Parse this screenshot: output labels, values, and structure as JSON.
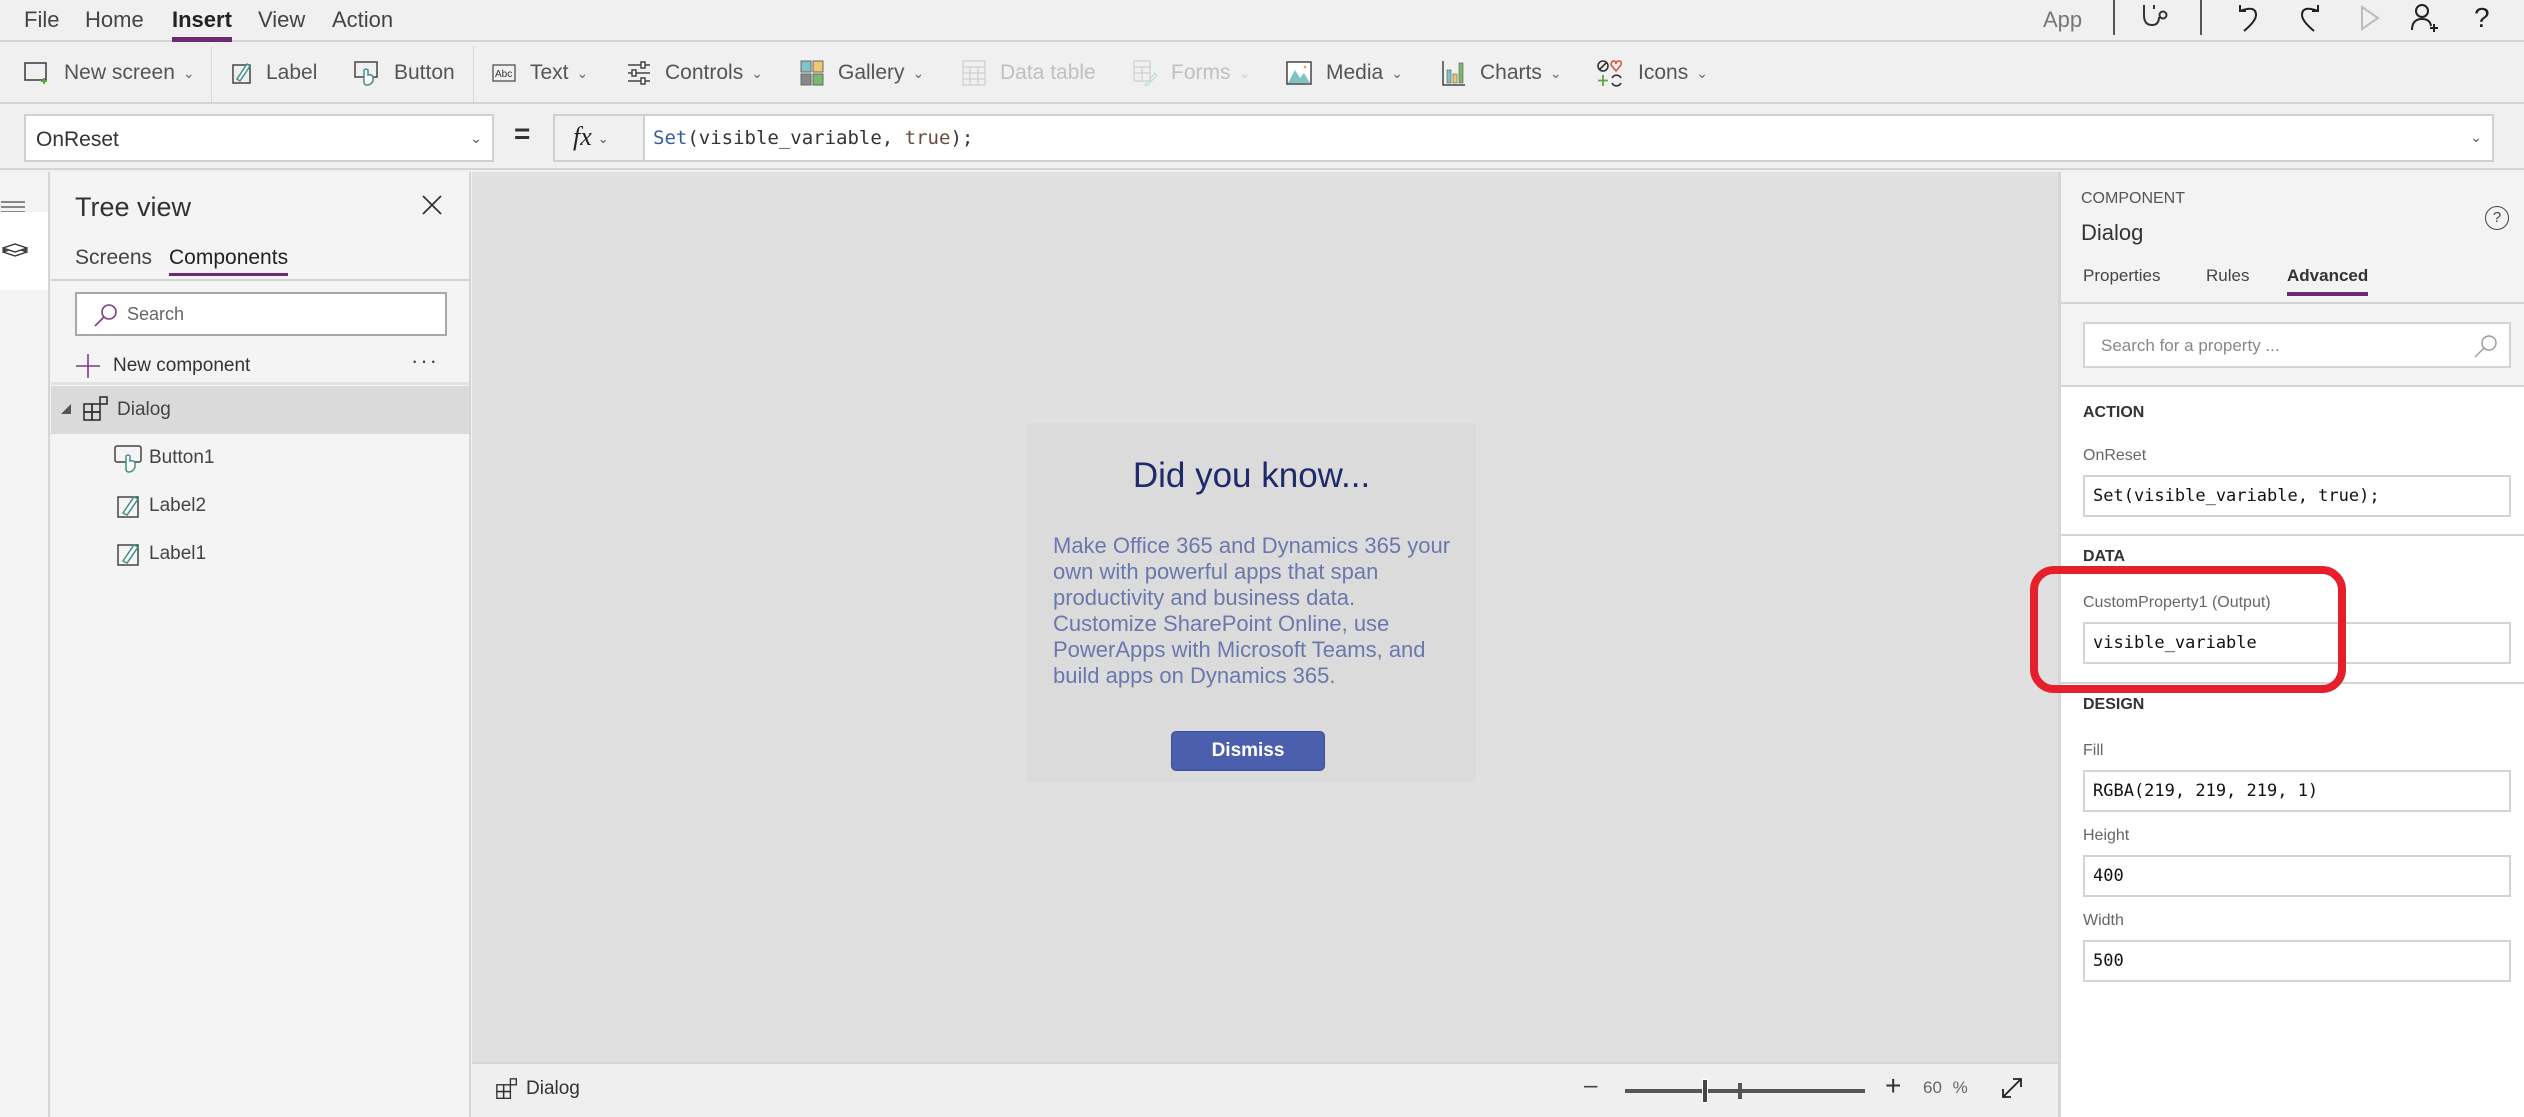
{
  "menubar": {
    "items": [
      "File",
      "Home",
      "Insert",
      "View",
      "Action"
    ],
    "active": "Insert",
    "app_label": "App"
  },
  "ribbon": {
    "new_screen": "New screen",
    "label": "Label",
    "button": "Button",
    "text": "Text",
    "controls": "Controls",
    "gallery": "Gallery",
    "data_table": "Data table",
    "forms": "Forms",
    "media": "Media",
    "charts": "Charts",
    "icons": "Icons"
  },
  "formula_bar": {
    "property": "OnReset",
    "equals": "=",
    "fx": "fx",
    "formula_fn": "Set",
    "formula_args_1": "(visible_variable, ",
    "formula_bool": "true",
    "formula_end": ");"
  },
  "tree": {
    "title": "Tree view",
    "tabs": [
      "Screens",
      "Components"
    ],
    "active_tab": "Components",
    "search_placeholder": "Search",
    "new_component": "New component",
    "more": "···",
    "nodes": [
      {
        "label": "Dialog",
        "type": "component",
        "selected": true,
        "expanded": true
      },
      {
        "label": "Button1",
        "type": "button"
      },
      {
        "label": "Label2",
        "type": "label"
      },
      {
        "label": "Label1",
        "type": "label"
      }
    ]
  },
  "canvas": {
    "dialog": {
      "title": "Did you know...",
      "body": "Make Office 365 and Dynamics 365 your own with powerful apps that span productivity and business data. Customize SharePoint Online, use PowerApps with Microsoft Teams, and build apps on Dynamics 365.",
      "dismiss": "Dismiss"
    }
  },
  "statusbar": {
    "screen": "Dialog",
    "zoom_value": "60",
    "zoom_unit": "%",
    "zoom_percent": 60
  },
  "right_panel": {
    "kind": "COMPONENT",
    "name": "Dialog",
    "help": "?",
    "tabs": [
      "Properties",
      "Rules",
      "Advanced"
    ],
    "active_tab": "Advanced",
    "search_placeholder": "Search for a property ...",
    "sections": {
      "action": {
        "title": "ACTION",
        "props": [
          {
            "label": "OnReset",
            "value": "Set(visible_variable, true);"
          }
        ]
      },
      "data": {
        "title": "DATA",
        "props": [
          {
            "label": "CustomProperty1 (Output)",
            "value": "visible_variable"
          }
        ]
      },
      "design": {
        "title": "DESIGN",
        "props": [
          {
            "label": "Fill",
            "value": "RGBA(219, 219, 219, 1)"
          },
          {
            "label": "Height",
            "value": "400"
          },
          {
            "label": "Width",
            "value": "500"
          }
        ]
      }
    }
  },
  "colors": {
    "accent": "#6b2b72",
    "dialog_title": "#1f2a6b",
    "dialog_body": "#6a78ae",
    "dismiss_button": "#4a5fad",
    "highlight": "#e5202a"
  }
}
